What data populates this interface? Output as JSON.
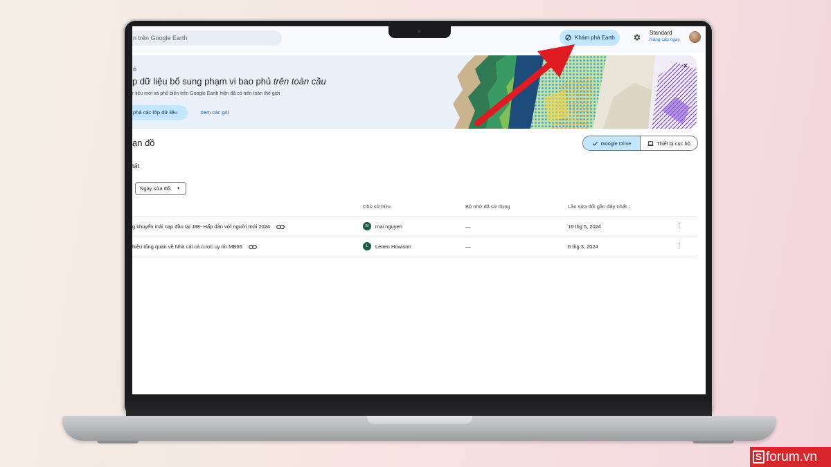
{
  "topbar": {
    "search_placeholder": "n trên Google Earth",
    "explore_label": "Khám phá Earth",
    "plan_name": "Standard",
    "plan_upgrade": "Nâng cấp ngay"
  },
  "banner": {
    "kicker": "ó",
    "title_prefix": "p dữ liệu bổ sung phạm vi bao phủ ",
    "title_emphasis": "trên toàn cầu",
    "description": "r liệu mới và phổ biến trên Google Earth hiện đã có trên toàn thế giới",
    "primary_label": "phá các lớp dữ liệu",
    "secondary_label": "Xem các gói",
    "close_symbol": "×"
  },
  "section": {
    "title": "ạn đồ",
    "subtitle": "tất",
    "filter_label": "Ngày sửa đổi"
  },
  "storage_toggle": {
    "drive_label": "Google Drive",
    "local_label": "Thiết bị cục bộ"
  },
  "table": {
    "headers": [
      "Chủ sở hữu",
      "Bộ nhớ đã sử dụng",
      "Lần sửa đổi gần đây nhất ↓"
    ],
    "rows": [
      {
        "name": "g khuyến mãi nạp đầu tại J88- Hấp dẫn với người mới 2024",
        "owner_initial": "m",
        "owner": "mai nguyen",
        "storage": "—",
        "modified": "16 thg 5, 2024"
      },
      {
        "name": "hiệu tổng quan về Nhà cái cá cược uy tín MB66",
        "owner_initial": "L",
        "owner": "Leneo Howison",
        "storage": "—",
        "modified": "6 thg 3, 2024"
      }
    ]
  },
  "watermark": {
    "logo_letter": "S",
    "text": "forum.vn"
  },
  "colors": {
    "accent_blue": "#c2e7ff",
    "arrow_red": "#e01b22",
    "watermark_red": "#d8262b",
    "owner_avatar": "#1e5b46"
  },
  "icons": [
    "explore-icon",
    "gear-icon",
    "check-icon",
    "laptop-icon",
    "link-icon",
    "close-icon",
    "kebab-icon",
    "caret-icon"
  ]
}
